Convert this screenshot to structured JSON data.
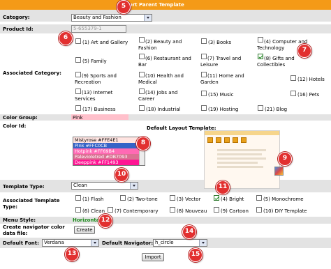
{
  "header": {
    "title": "Import Parent Template"
  },
  "category": {
    "label": "Category:",
    "value": "Beauty and Fashion"
  },
  "product_id": {
    "label": "Product Id:",
    "value": "5-655379-1"
  },
  "associated_category": {
    "label": "Associated Category:",
    "options": [
      {
        "label": "(1) Art and Gallery",
        "checked": false
      },
      {
        "label": "(2) Beauty and Fashion",
        "checked": false
      },
      {
        "label": "(3) Books",
        "checked": false
      },
      {
        "label": "(4) Computer and Technology",
        "checked": false
      },
      {
        "label": "(5) Family",
        "checked": false
      },
      {
        "label": "(6) Restaurant and Bar",
        "checked": false
      },
      {
        "label": "(7) Travel and Leisure",
        "checked": false
      },
      {
        "label": "(8) Gifts and Collectibles",
        "checked": true
      },
      {
        "label": "(9) Sports and Recreation",
        "checked": false
      },
      {
        "label": "(10) Health and Medical",
        "checked": false
      },
      {
        "label": "(11) Home and Garden",
        "checked": false
      },
      {
        "label": "(12) Hotels",
        "checked": false
      },
      {
        "label": "(13) Internet Services",
        "checked": false
      },
      {
        "label": "(14) Jobs and Career",
        "checked": false
      },
      {
        "label": "(15) Music",
        "checked": false
      },
      {
        "label": "(16) Pets",
        "checked": false
      },
      {
        "label": "(17) Business",
        "checked": false
      },
      {
        "label": "(18) Industrial",
        "checked": false
      },
      {
        "label": "(19) Hosting",
        "checked": false
      },
      {
        "label": "(21) Blog",
        "checked": false
      }
    ]
  },
  "color_group": {
    "label": "Color Group:",
    "value": "Pink"
  },
  "color_id": {
    "label": "Color Id:",
    "items": [
      {
        "label": "Mistyrose #FFE4E1",
        "bg": "#ffe4e1",
        "fg": "#000000"
      },
      {
        "label": "Pink #FFC0CB",
        "bg": "#3563c7",
        "fg": "#ffffff"
      },
      {
        "label": "Hotpink #FF69B4",
        "bg": "#ff69b4",
        "fg": "#ffffff"
      },
      {
        "label": "Palevioletred #DB7093",
        "bg": "#db7093",
        "fg": "#ffffff"
      },
      {
        "label": "Deeppink #FF1493",
        "bg": "#ff1493",
        "fg": "#ffffff"
      }
    ]
  },
  "default_layout_template": {
    "label": "Default Layout Template:"
  },
  "template_type": {
    "label": "Template Type:",
    "value": "Clean"
  },
  "associated_template_type": {
    "label_line1": "Associated Template",
    "label_line2": "Type:",
    "options": [
      {
        "label": "(1) Flash",
        "checked": false
      },
      {
        "label": "(2) Two-tone",
        "checked": false
      },
      {
        "label": "(3) Vector",
        "checked": false
      },
      {
        "label": "(4) Bright",
        "checked": true
      },
      {
        "label": "(5) Monochrome",
        "checked": false
      },
      {
        "label": "(6) Clean",
        "checked": false
      },
      {
        "label": "(7) Contemporary",
        "checked": false
      },
      {
        "label": "(8) Nouveau",
        "checked": false
      },
      {
        "label": "(9) Cartoon",
        "checked": false
      },
      {
        "label": "(10) DIY Template",
        "checked": false
      }
    ]
  },
  "menu_style": {
    "label": "Menu Style:",
    "value": "Horizontal"
  },
  "navigator": {
    "label_line1": "Create navigator color",
    "label_line2": "data file:",
    "button": "Create"
  },
  "default_font": {
    "label": "Default Font:",
    "value": "Verdana"
  },
  "default_navigator": {
    "label": "Default Navigator:",
    "value": "h_circle"
  },
  "import_button": "Import",
  "badges": [
    "5",
    "6",
    "7",
    "8",
    "9",
    "10",
    "11",
    "12",
    "13",
    "14",
    "15"
  ],
  "colors": {
    "header": "#f49a17",
    "row_alt": "#e3e3e3",
    "badge": "#e23030",
    "menu_style_text": "#1a8a1a"
  }
}
